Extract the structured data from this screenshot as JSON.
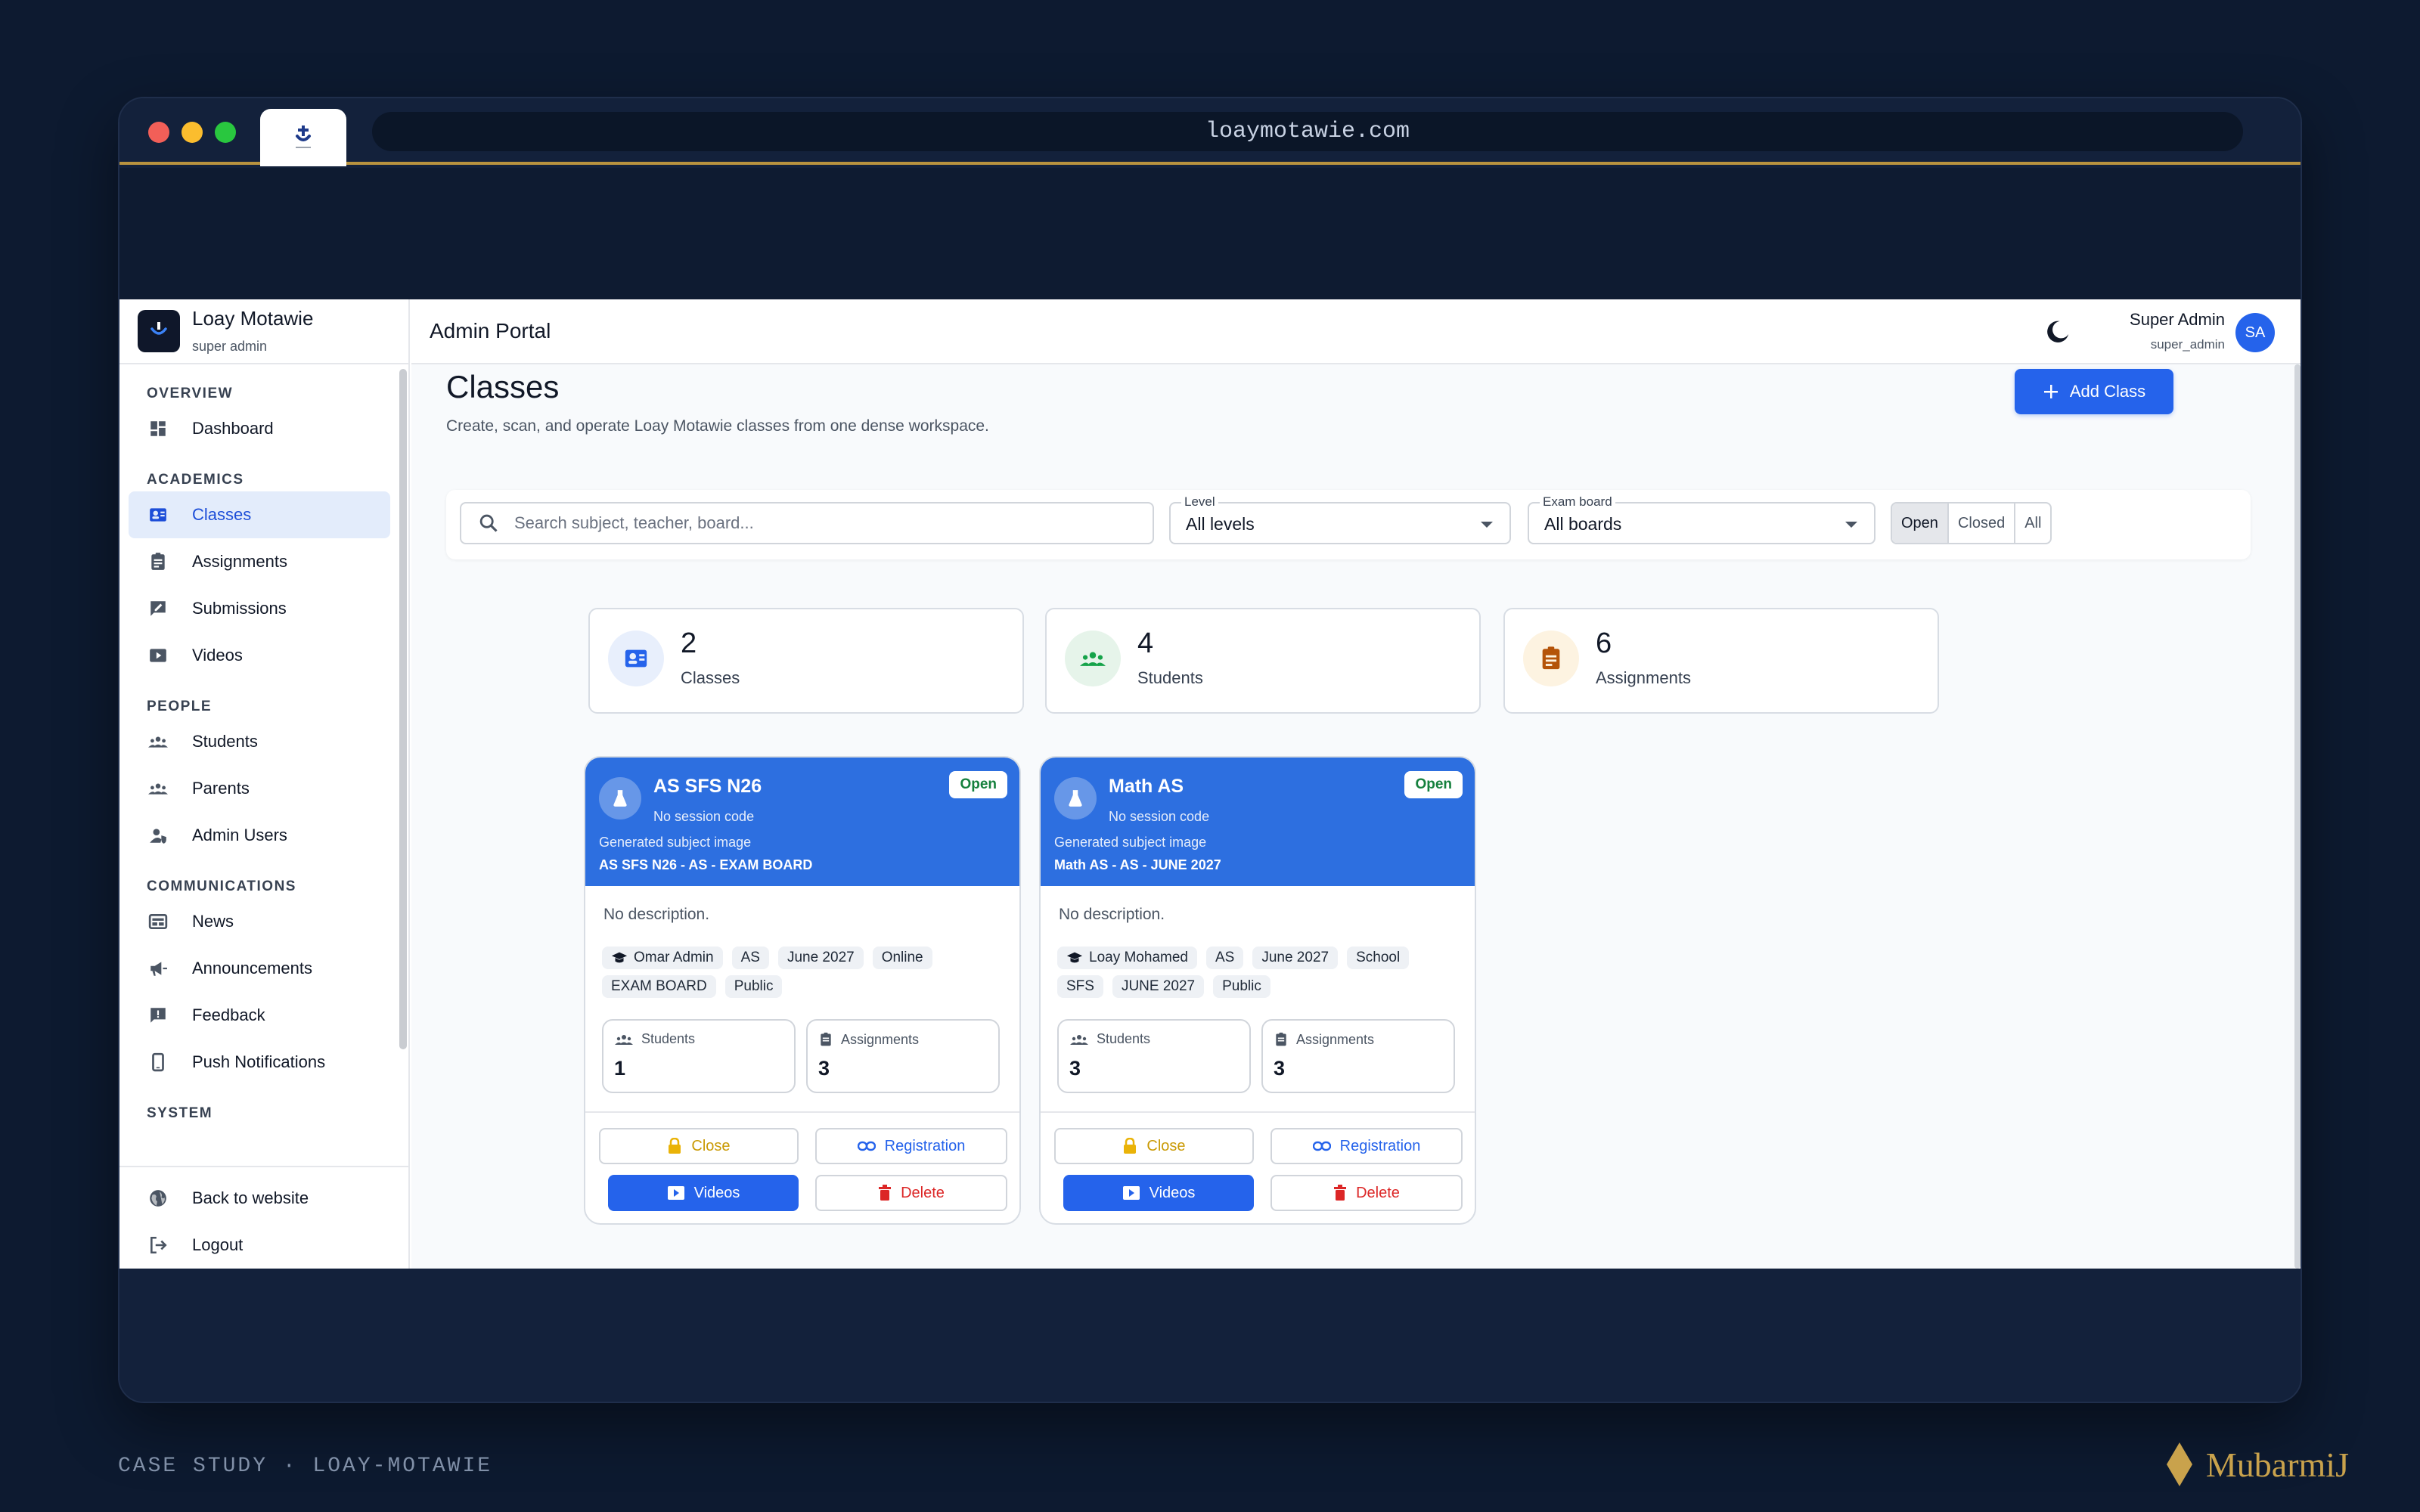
{
  "browser": {
    "url": "loaymotawie.com"
  },
  "brand": {
    "name": "Loay Motawie",
    "role": "super admin"
  },
  "topbar": {
    "title": "Admin Portal",
    "user_name": "Super Admin",
    "user_role": "super_admin",
    "avatar": "SA"
  },
  "sidebar": {
    "sections": {
      "overview": "OVERVIEW",
      "academics": "ACADEMICS",
      "people": "PEOPLE",
      "communications": "COMMUNICATIONS",
      "system": "SYSTEM"
    },
    "items": {
      "dashboard": "Dashboard",
      "classes": "Classes",
      "assignments": "Assignments",
      "submissions": "Submissions",
      "videos": "Videos",
      "students": "Students",
      "parents": "Parents",
      "admin_users": "Admin Users",
      "news": "News",
      "announcements": "Announcements",
      "feedback": "Feedback",
      "push_notifications": "Push Notifications"
    },
    "bottom": {
      "back": "Back to website",
      "logout": "Logout"
    }
  },
  "page": {
    "title": "Classes",
    "subtitle": "Create, scan, and operate Loay Motawie classes from one dense workspace.",
    "add_button": "Add Class"
  },
  "filters": {
    "search_placeholder": "Search subject, teacher, board...",
    "level_label": "Level",
    "level_value": "All levels",
    "board_label": "Exam board",
    "board_value": "All boards",
    "status_options": [
      "Open",
      "Closed",
      "All"
    ],
    "status_selected": "Open"
  },
  "stats": [
    {
      "value": "2",
      "label": "Classes",
      "icon": "classes-icon",
      "color": "#2563eb"
    },
    {
      "value": "4",
      "label": "Students",
      "icon": "students-icon",
      "color": "#16a34a"
    },
    {
      "value": "6",
      "label": "Assignments",
      "icon": "assignments-icon",
      "color": "#b45309"
    }
  ],
  "cards": [
    {
      "title": "AS SFS N26",
      "session": "No session code",
      "status": "Open",
      "image_caption": "Generated subject image",
      "image_title": "AS SFS N26 - AS - EXAM BOARD",
      "description": "No description.",
      "teacher": "Omar Admin",
      "tags": [
        "AS",
        "June 2027",
        "Online",
        "EXAM BOARD",
        "Public"
      ],
      "students_label": "Students",
      "students": "1",
      "assignments_label": "Assignments",
      "assignments": "3",
      "actions": {
        "close": "Close",
        "registration": "Registration",
        "videos": "Videos",
        "delete": "Delete"
      }
    },
    {
      "title": "Math AS",
      "session": "No session code",
      "status": "Open",
      "image_caption": "Generated subject image",
      "image_title": "Math AS - AS - JUNE 2027",
      "description": "No description.",
      "teacher": "Loay Mohamed",
      "tags": [
        "AS",
        "June 2027",
        "School",
        "SFS",
        "JUNE 2027",
        "Public"
      ],
      "students_label": "Students",
      "students": "3",
      "assignments_label": "Assignments",
      "assignments": "3",
      "actions": {
        "close": "Close",
        "registration": "Registration",
        "videos": "Videos",
        "delete": "Delete"
      }
    }
  ],
  "footer": {
    "left": "CASE STUDY · LOAY-MOTAWIE",
    "right": "MubarmiJ"
  },
  "colors": {
    "primary": "#2563eb",
    "accent_gold": "#c9a24c",
    "background": "#0d1a30"
  }
}
